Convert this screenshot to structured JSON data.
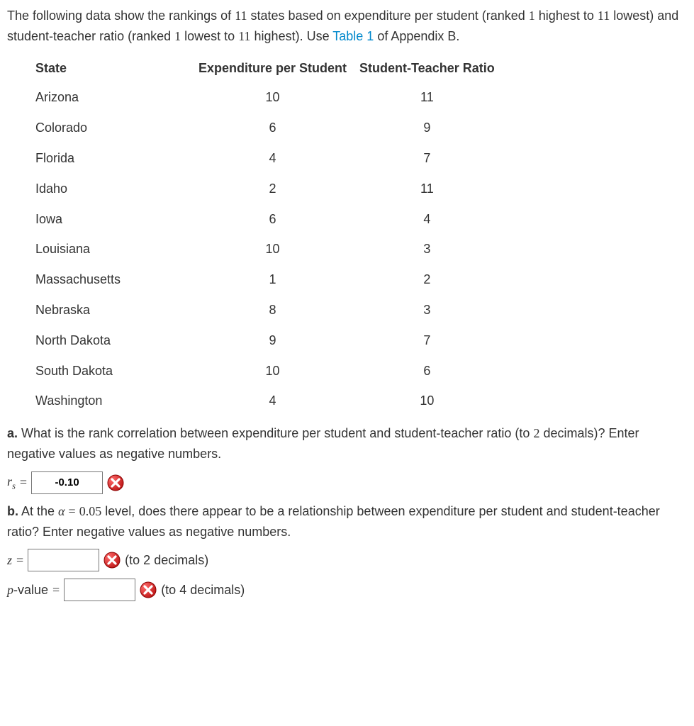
{
  "intro": {
    "part1": "The following data show the rankings of ",
    "num_states": "11",
    "part2": " states based on expenditure per student (ranked ",
    "rank_hi": "1",
    "part3": " highest to ",
    "rank_lo": "11",
    "part4": " lowest) and student-teacher ratio (ranked ",
    "ratio_lo": "1",
    "part5": " lowest to ",
    "ratio_hi": "11",
    "part6": " highest). Use ",
    "table_link": "Table 1",
    "part7": " of Appendix B."
  },
  "table": {
    "headers": {
      "state": "State",
      "expenditure": "Expenditure per Student",
      "ratio": "Student-Teacher Ratio"
    },
    "rows": [
      {
        "state": "Arizona",
        "expenditure": "10",
        "ratio": "11"
      },
      {
        "state": "Colorado",
        "expenditure": "6",
        "ratio": "9"
      },
      {
        "state": "Florida",
        "expenditure": "4",
        "ratio": "7"
      },
      {
        "state": "Idaho",
        "expenditure": "2",
        "ratio": "11"
      },
      {
        "state": "Iowa",
        "expenditure": "6",
        "ratio": "4"
      },
      {
        "state": "Louisiana",
        "expenditure": "10",
        "ratio": "3"
      },
      {
        "state": "Massachusetts",
        "expenditure": "1",
        "ratio": "2"
      },
      {
        "state": "Nebraska",
        "expenditure": "8",
        "ratio": "3"
      },
      {
        "state": "North Dakota",
        "expenditure": "9",
        "ratio": "7"
      },
      {
        "state": "South Dakota",
        "expenditure": "10",
        "ratio": "6"
      },
      {
        "state": "Washington",
        "expenditure": "4",
        "ratio": "10"
      }
    ]
  },
  "part_a": {
    "label": "a.",
    "text1": " What is the rank correlation between expenditure per student and student-teacher ratio (to ",
    "decimals": "2",
    "text2": " decimals)? Enter negative values as negative numbers.",
    "symbol": "r",
    "sub": "s",
    "equals": "=",
    "value": "-0.10"
  },
  "part_b": {
    "label": "b.",
    "text1": " At the ",
    "alpha_sym": "α",
    "equals": "=",
    "alpha_val": "0.05",
    "text2": " level, does there appear to be a relationship between expenditure per student and student-teacher ratio? Enter negative values as negative numbers.",
    "z_sym": "z",
    "z_eq": "=",
    "z_value": "",
    "z_hint": "(to 2 decimals)",
    "p_sym": "p",
    "p_label": "-value ",
    "p_eq": "=",
    "p_value": "",
    "p_hint": "(to 4 decimals)"
  }
}
